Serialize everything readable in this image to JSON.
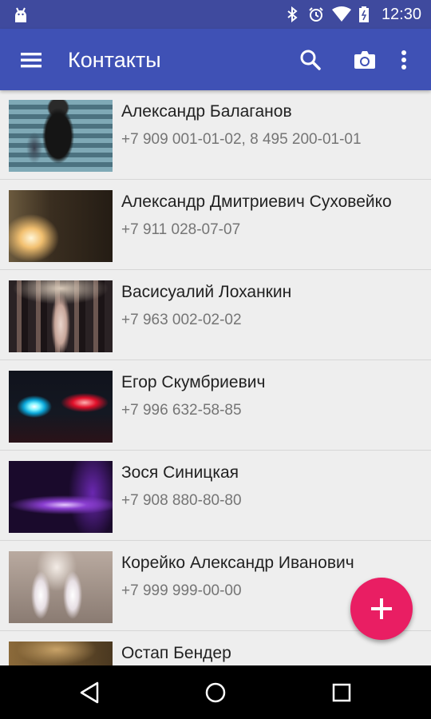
{
  "status_bar": {
    "time": "12:30",
    "icons": [
      "android-icon",
      "bluetooth-icon",
      "alarm-icon",
      "wifi-icon",
      "battery-icon"
    ]
  },
  "app_bar": {
    "title": "Контакты",
    "actions": [
      "menu-icon",
      "search-icon",
      "camera-icon",
      "overflow-icon"
    ],
    "color": "#3f51b5"
  },
  "contacts": [
    {
      "name": "Александр Балаганов",
      "phone": "+7 909 001-01-02, 8 495 200-01-01"
    },
    {
      "name": "Александр Дмитриевич Суховейко",
      "phone": "+7 911 028-07-07"
    },
    {
      "name": "Васисуалий Лоханкин",
      "phone": "+7 963 002-02-02"
    },
    {
      "name": "Егор Скумбриевич",
      "phone": "+7 996 632-58-85"
    },
    {
      "name": "Зося Синицкая",
      "phone": "+7 908 880-80-80"
    },
    {
      "name": "Корейко Александр Иванович",
      "phone": "+7 999 999-00-00"
    },
    {
      "name": "Остап Бендер",
      "phone": ""
    }
  ],
  "fab": {
    "icon": "plus-icon",
    "color": "#e91e63"
  },
  "nav_bar": {
    "icons": [
      "back-icon",
      "home-icon",
      "recents-icon"
    ]
  }
}
